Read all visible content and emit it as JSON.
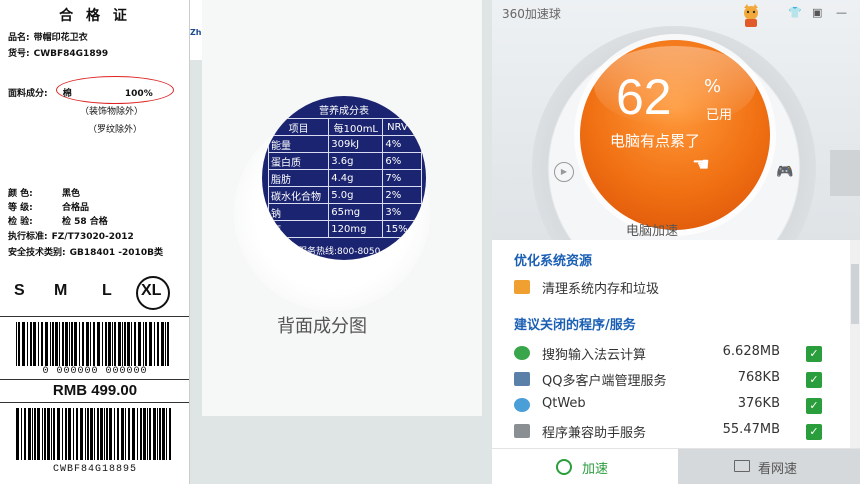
{
  "tag": {
    "title": "合 格 证",
    "product_label": "品名:",
    "product_value": "带帽印花卫衣",
    "sku_label": "货号:",
    "sku_value": "CWBF84G1899",
    "fabric_label": "面料成分:",
    "fabric_material": "棉",
    "fabric_percent": "100%",
    "excl1": "（装饰物除外）",
    "excl2": "（罗纹除外）",
    "color_label": "颜 色:",
    "color_value": "黑色",
    "grade_label": "等 级:",
    "grade_value": "合格品",
    "inspect_label": "检 验:",
    "inspect_value": "检 58 合格",
    "standard_label": "执行标准:",
    "standard_value": "FZ/T73020-2012",
    "safety_label": "安全技术类别:",
    "safety_value": "GB18401 -2010B类",
    "sizes": [
      "S",
      "M",
      "L",
      "XL"
    ],
    "barcode1_number": "0 000000 000000",
    "price": "RMB 499.00",
    "barcode2_number": "CWBF84G18895"
  },
  "back": {
    "sliver_text": "Zh",
    "nutrition_title": "营养成分表",
    "header": [
      "项目",
      "每100mL",
      "NRV%"
    ],
    "rows": [
      [
        "能量",
        "309kJ",
        "4%"
      ],
      [
        "蛋白质",
        "3.6g",
        "6%"
      ],
      [
        "脂肪",
        "4.4g",
        "7%"
      ],
      [
        "碳水化合物",
        "5.0g",
        "2%"
      ],
      [
        "钠",
        "65mg",
        "3%"
      ],
      [
        "钙",
        "120mg",
        "15%"
      ]
    ],
    "hotline": "服务热线:800-8050",
    "caption": "背面成分图"
  },
  "accelerator": {
    "app_title": "360加速球",
    "percent": "62",
    "percent_sign": "%",
    "used_label": "已用",
    "status": "电脑有点累了",
    "boost_label": "电脑加速",
    "section1": "优化系统资源",
    "clean_item": "清理系统内存和垃圾",
    "section2": "建议关闭的程序/服务",
    "programs": [
      {
        "name": "搜狗输入法云计算",
        "size": "6.628MB",
        "icon_color": "#3aa64b"
      },
      {
        "name": "QQ多客户端管理服务",
        "size": "768KB",
        "icon_color": "#5a7fa8"
      },
      {
        "name": "QtWeb",
        "size": "376KB",
        "icon_color": "#4a9fd8"
      },
      {
        "name": "程序兼容助手服务",
        "size": "55.47MB",
        "icon_color": "#8a8f94"
      }
    ],
    "check_mark": "✓",
    "accelerate_button": "加速",
    "view_web_button": "看网速",
    "accent": "#f07012",
    "brand_green": "#2a9d3c",
    "link_blue": "#1a5fb4"
  }
}
